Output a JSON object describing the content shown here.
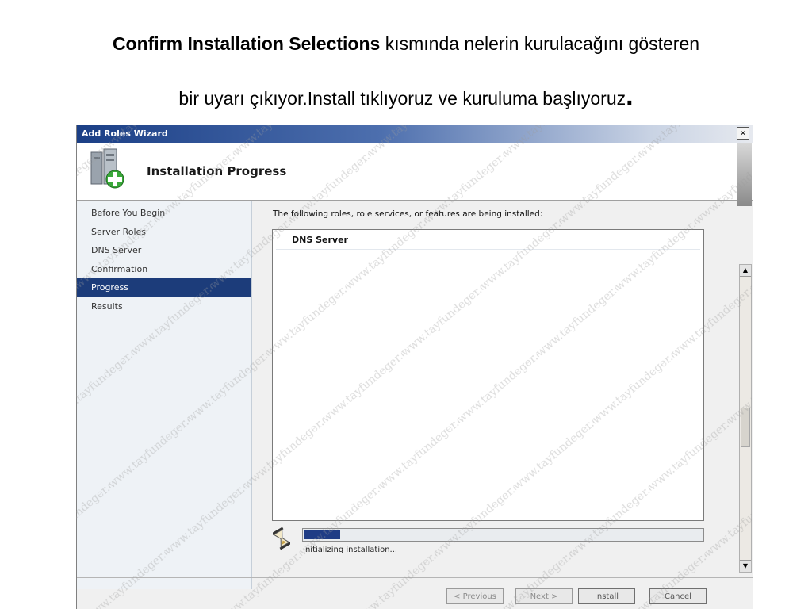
{
  "caption": {
    "line1_bold": "Confirm Installation Selections",
    "line1_rest": " kısmında nelerin kurulacağını gösteren",
    "line2": "bir uyarı çıkıyor.Install tıklıyoruz ve kuruluma başlıyoruz",
    "line2_dot": "."
  },
  "window": {
    "title": "Add Roles Wizard",
    "close_glyph": "×",
    "header_title": "Installation Progress",
    "header_icon": "server-add-icon"
  },
  "nav": {
    "items": [
      {
        "label": "Before You Begin",
        "active": false
      },
      {
        "label": "Server Roles",
        "active": false
      },
      {
        "label": "DNS Server",
        "active": false
      },
      {
        "label": "Confirmation",
        "active": false
      },
      {
        "label": "Progress",
        "active": true
      },
      {
        "label": "Results",
        "active": false
      }
    ]
  },
  "content": {
    "description": "The following roles, role services, or features are being installed:",
    "list_items": [
      "DNS Server"
    ],
    "progress_fraction": 0.09,
    "status_text": "Initializing installation..."
  },
  "buttons": {
    "previous": "< Previous",
    "next": "Next >",
    "install": "Install",
    "cancel": "Cancel"
  },
  "watermark_text": "www.tayfundeger.com",
  "colors": {
    "accent": "#1c3c7a",
    "progress": "#1f3c85"
  }
}
